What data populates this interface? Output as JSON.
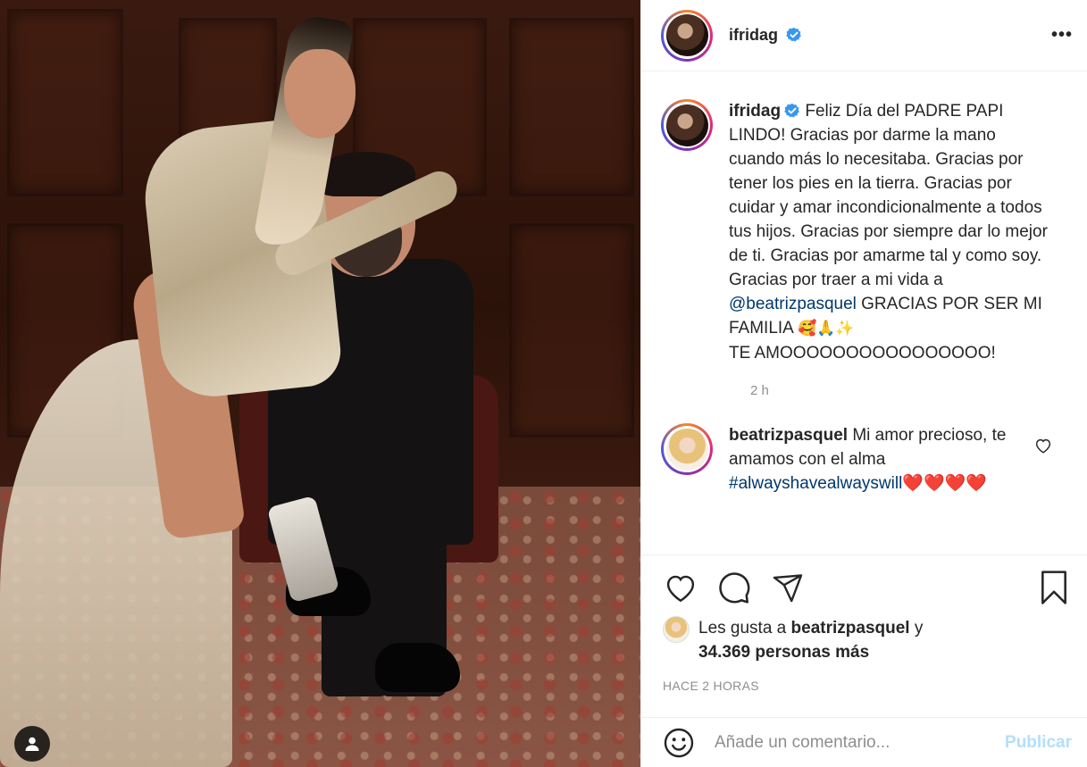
{
  "post": {
    "author": "ifridag",
    "verified": true,
    "more_icon": "more-horizontal-icon"
  },
  "caption": {
    "author": "ifridag",
    "text_before_mention": " Feliz Día del PADRE PAPI LINDO! Gracias por darme la mano cuando más lo necesitaba. Gracias por tener los pies en la tierra. Gracias por cuidar y amar incondicionalmente a todos tus hijos. Gracias por siempre dar lo mejor de ti. Gracias por amarme tal y como soy. Gracias por traer a mi vida a ",
    "mention": "@beatrizpasquel",
    "text_after_mention": " GRACIAS POR SER MI FAMILIA ",
    "emojis": "🥰🙏✨",
    "final_line": "TE AMOOOOOOOOOOOOOOOO!",
    "time": "2 h"
  },
  "reply": {
    "author": "beatrizpasquel",
    "text": " Mi amor precioso, te amamos con el alma ",
    "hashtag": "#alwayshavealwayswill",
    "hearts": "❤️❤️❤️❤️"
  },
  "likes": {
    "prefix": "Les gusta a ",
    "user": "beatrizpasquel",
    "connector": " y ",
    "others": "34.369 personas más"
  },
  "posted_ago": "HACE 2 HORAS",
  "comment_box": {
    "placeholder": "Añade un comentario...",
    "publish_label": "Publicar"
  },
  "colors": {
    "link": "#00376b",
    "muted": "#8e8e8e",
    "publish_disabled": "#b2dffc",
    "verified": "#3897f0"
  }
}
